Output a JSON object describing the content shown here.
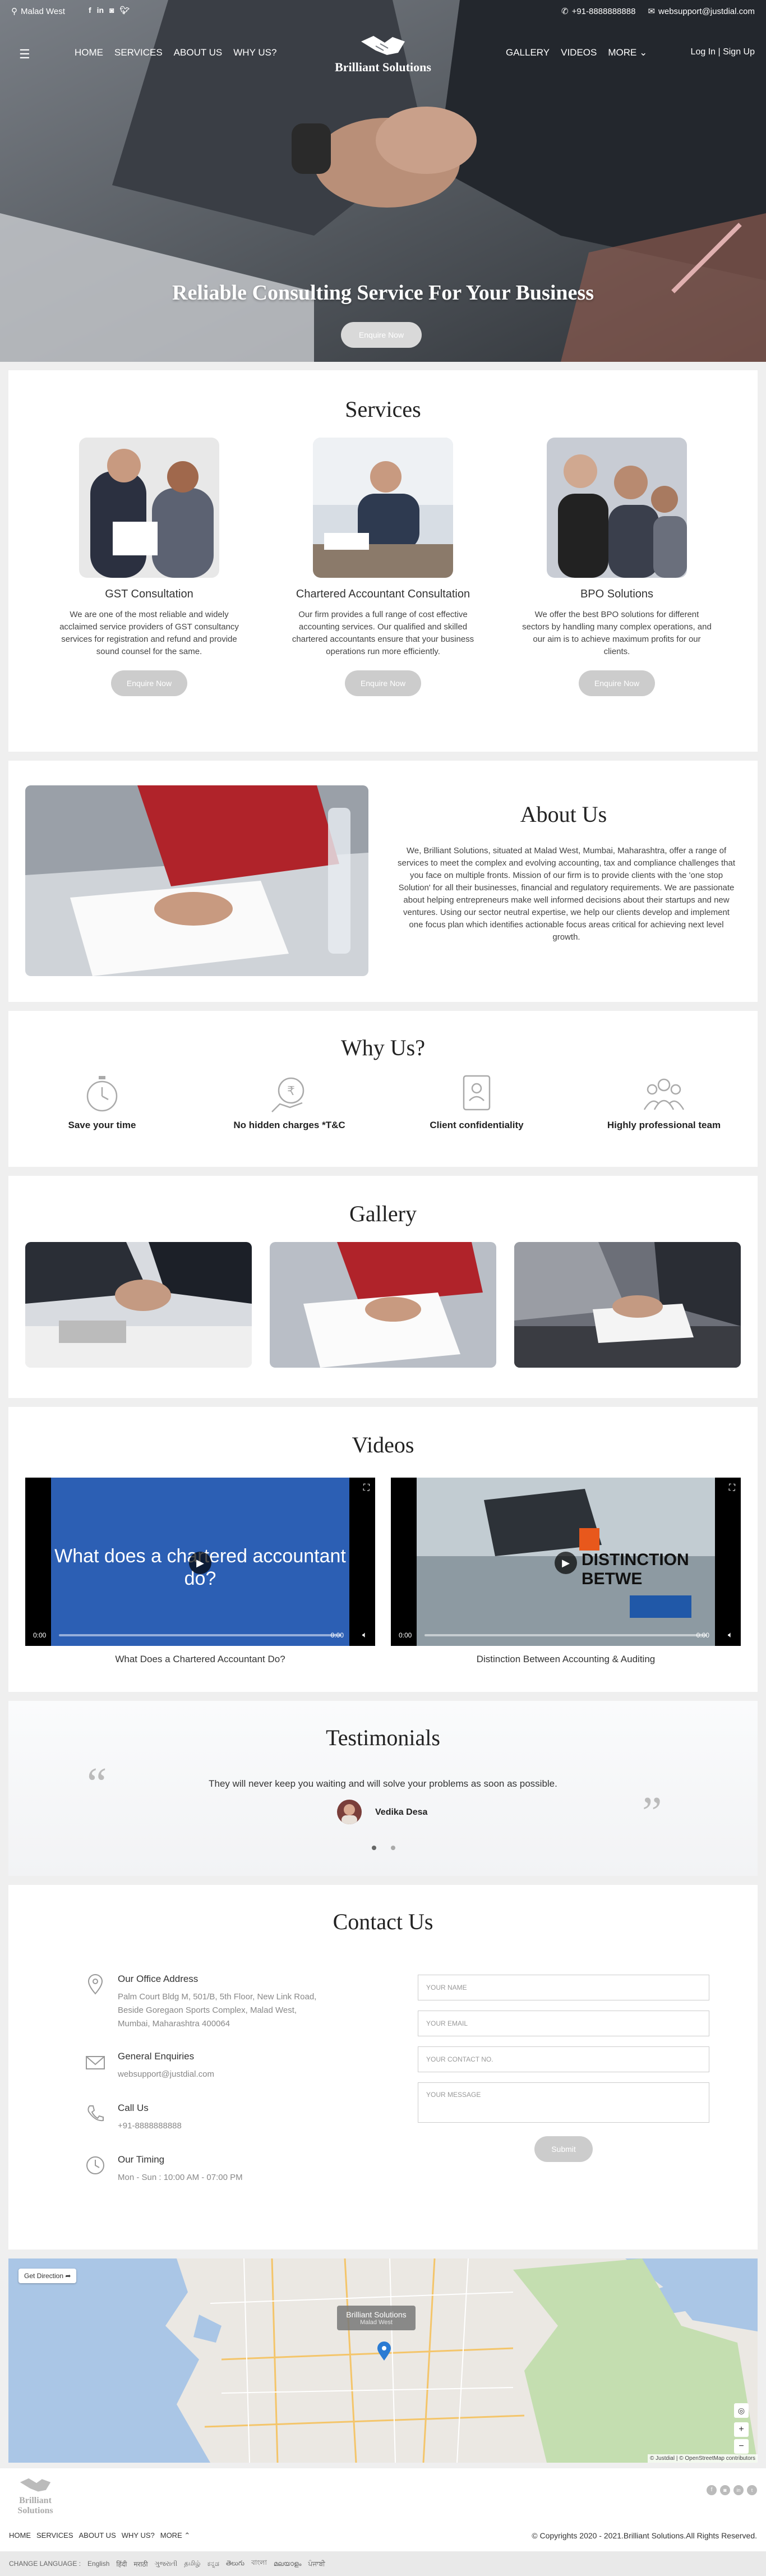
{
  "topbar": {
    "location": "Malad West",
    "social": [
      "f",
      "in",
      "ig",
      "tw"
    ],
    "phone": "+91-8888888888",
    "email": "websupport@justdial.com"
  },
  "nav": {
    "left": [
      "HOME",
      "SERVICES",
      "ABOUT US",
      "WHY US?"
    ],
    "right": [
      "GALLERY",
      "VIDEOS",
      "MORE"
    ],
    "brand": "Brilliant Solutions",
    "login": "Log In | Sign Up"
  },
  "hero": {
    "title": "Reliable Consulting Service For Your Business",
    "button": "Enquire Now"
  },
  "services": {
    "title": "Services",
    "items": [
      {
        "title": "GST Consultation",
        "text": "We are one of the most reliable and widely acclaimed service providers of GST consultancy services for registration and refund and provide sound counsel for the same.",
        "button": "Enquire Now"
      },
      {
        "title": "Chartered Accountant Consultation",
        "text": "Our firm provides a full range of cost effective accounting services. Our qualified and skilled chartered accountants ensure that your business operations run more efficiently.",
        "button": "Enquire Now"
      },
      {
        "title": "BPO Solutions",
        "text": "We offer the best BPO solutions for different sectors by handling many complex operations, and our aim is to achieve maximum profits for our clients.",
        "button": "Enquire Now"
      }
    ]
  },
  "about": {
    "title": "About Us",
    "text": "We, Brilliant Solutions, situated at Malad West, Mumbai, Maharashtra, offer a range of services to meet the complex and evolving accounting, tax and compliance challenges that you face on multiple fronts. Mission of our firm is to provide clients with the 'one stop Solution' for all their businesses, financial and regulatory requirements. We are passionate about helping entrepreneurs make well informed decisions about their startups and new ventures. Using our sector neutral expertise, we help our clients develop and implement one focus plan which identifies actionable focus areas critical for achieving next level growth."
  },
  "why": {
    "title": "Why Us?",
    "items": [
      {
        "label": "Save your time",
        "icon": "stopwatch-icon"
      },
      {
        "label": "No hidden charges *T&C",
        "icon": "no-hidden-charges-icon"
      },
      {
        "label": "Client confidentiality",
        "icon": "confidential-document-icon"
      },
      {
        "label": "Highly professional team",
        "icon": "team-icon"
      }
    ]
  },
  "gallery": {
    "title": "Gallery"
  },
  "videos": {
    "title": "Videos",
    "items": [
      {
        "overlay": "What does a chartered accountant do?",
        "caption": "What Does a Chartered Accountant Do?",
        "time_start": "0:00",
        "time_end": "0:00"
      },
      {
        "overlay": "DISTINCTION BETWE",
        "caption": "Distinction Between Accounting & Auditing",
        "time_start": "0:00",
        "time_end": "0:00"
      }
    ]
  },
  "testimonials": {
    "title": "Testimonials",
    "quote": "They will never keep you waiting and will solve your problems as soon as possible.",
    "author": "Vedika Desa"
  },
  "contact": {
    "title": "Contact Us",
    "office_title": "Our Office Address",
    "office_text": "Palm Court Bldg M, 501/B, 5th Floor, New Link Road, Beside Goregaon Sports Complex, Malad West, Mumbai, Maharashtra 400064",
    "enq_title": "General Enquiries",
    "enq_text": "websupport@justdial.com",
    "call_title": "Call Us",
    "call_text": "+91-8888888888",
    "timing_title": "Our Timing",
    "timing_text": "Mon - Sun : 10:00 AM - 07:00 PM",
    "name_ph": "Your Name",
    "email_ph": "Your Email",
    "contact_ph": "Your Contact No.",
    "message_ph": "Your Message",
    "submit": "Submit"
  },
  "map": {
    "get_direction": "Get Direction",
    "marker_name": "Brilliant Solutions",
    "marker_sub": "Malad West",
    "attribution": "© Justdial | © OpenStreetMap contributors"
  },
  "footer": {
    "brand": "Brilliant Solutions",
    "links": [
      "HOME",
      "SERVICES",
      "ABOUT US",
      "WHY US?",
      "MORE"
    ],
    "copyright": "© Copyrights 2020 - 2021.Brilliant Solutions.All Rights Reserved.",
    "change_language": "CHANGE LANGUAGE :",
    "languages": [
      "English",
      "हिंदी",
      "मराठी",
      "ગુજરાતી",
      "தமிழ்",
      "ಕನ್ನಡ",
      "తెలుగు",
      "বাংলা",
      "മലയാളം",
      "ਪੰਜਾਬੀ"
    ]
  }
}
